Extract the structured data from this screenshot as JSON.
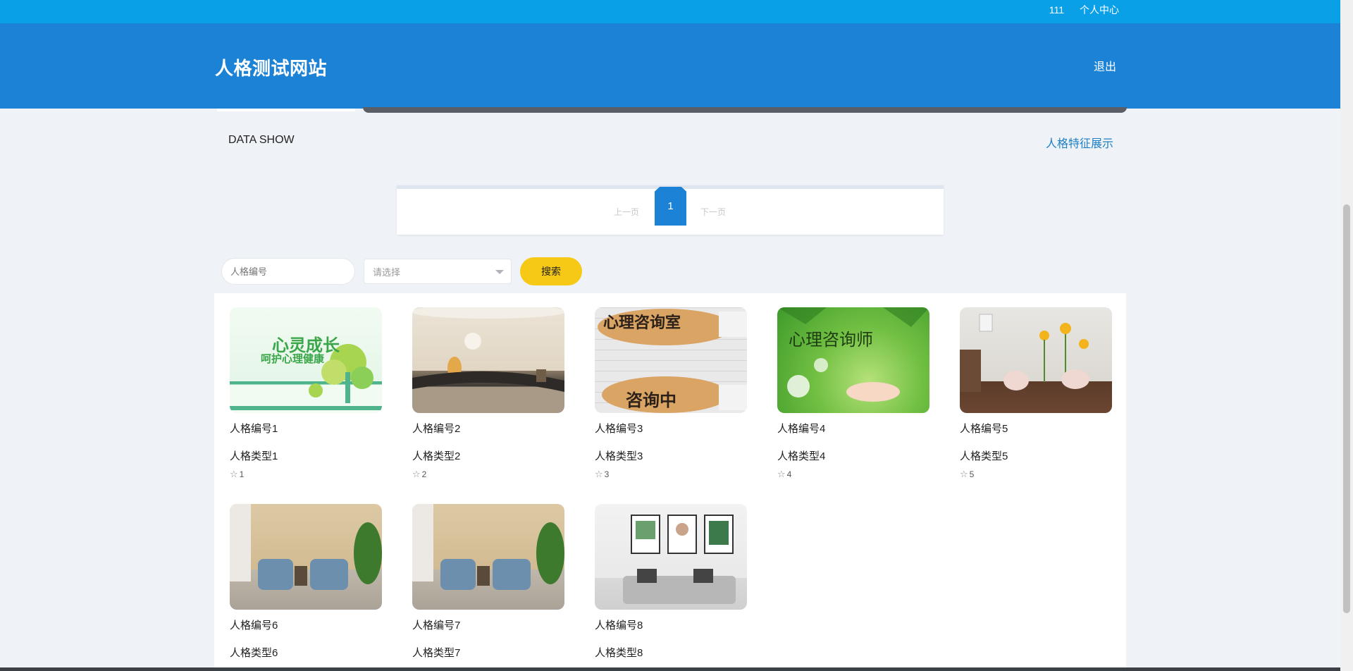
{
  "topbar": {
    "user": "111",
    "profile": "个人中心"
  },
  "header": {
    "brand": "人格测试网站",
    "logout": "退出"
  },
  "section": {
    "title": "DATA SHOW",
    "link": "人格特征展示"
  },
  "pager": {
    "prev": "上一页",
    "current": "1",
    "next": "下一页"
  },
  "search": {
    "placeholder": "人格编号",
    "select_value": "请选择",
    "button": "搜索"
  },
  "cards": [
    {
      "name": "人格编号1",
      "type": "人格类型1",
      "fav": "1",
      "image": "heart-growth-poster",
      "overlay": "心灵成长",
      "overlay2": "呵护心理健康"
    },
    {
      "name": "人格编号2",
      "type": "人格类型2",
      "fav": "2",
      "image": "reception-lobby"
    },
    {
      "name": "人格编号3",
      "type": "人格类型3",
      "fav": "3",
      "image": "consultation-room-sign",
      "overlay": "心理咨询室",
      "overlay2": "咨询中"
    },
    {
      "name": "人格编号4",
      "type": "人格类型4",
      "fav": "4",
      "image": "counselor-green-poster",
      "overlay": "心理咨询师"
    },
    {
      "name": "人格编号5",
      "type": "人格类型5",
      "fav": "5",
      "image": "sunflower-wall-room"
    },
    {
      "name": "人格编号6",
      "type": "人格类型6",
      "fav": "",
      "image": "blue-armchairs-room"
    },
    {
      "name": "人格编号7",
      "type": "人格类型7",
      "fav": "",
      "image": "blue-armchairs-room"
    },
    {
      "name": "人格编号8",
      "type": "人格类型8",
      "fav": "",
      "image": "sofa-gallery-room"
    }
  ]
}
